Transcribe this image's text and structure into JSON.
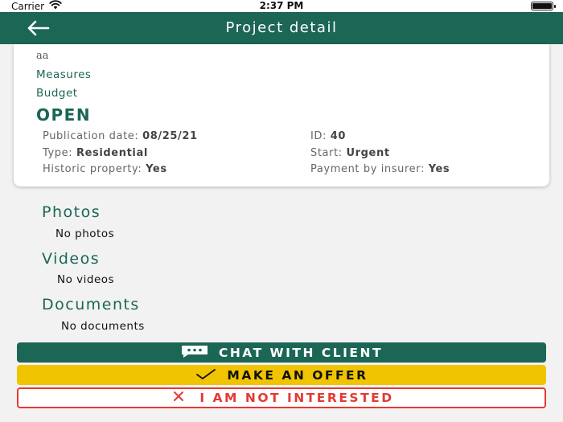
{
  "status_bar": {
    "carrier": "Carrier",
    "time": "2:37 PM"
  },
  "header": {
    "title": "Project detail",
    "back_icon": "arrow-left-icon"
  },
  "project": {
    "description": "aa",
    "measures_link": "Measures",
    "budget_link": "Budget",
    "status": "OPEN",
    "publication_label": "Publication date:",
    "publication_value": "08/25/21",
    "id_label": "ID:",
    "id_value": "40",
    "type_label": "Type:",
    "type_value": "Residential",
    "start_label": "Start:",
    "start_value": "Urgent",
    "historic_label": "Historic property:",
    "historic_value": "Yes",
    "insurer_label": "Payment by insurer:",
    "insurer_value": "Yes"
  },
  "sections": {
    "photos": {
      "title": "Photos",
      "empty": "No photos"
    },
    "videos": {
      "title": "Videos",
      "empty": "No videos"
    },
    "documents": {
      "title": "Documents",
      "empty": "No documents"
    }
  },
  "actions": {
    "chat_label": "CHAT WITH CLIENT",
    "offer_label": "MAKE AN OFFER",
    "not_interested_label": "I AM NOT INTERESTED"
  },
  "colors": {
    "primary": "#1c6656",
    "offer": "#f0c400",
    "danger": "#e53935",
    "background": "#f2f2f2"
  }
}
